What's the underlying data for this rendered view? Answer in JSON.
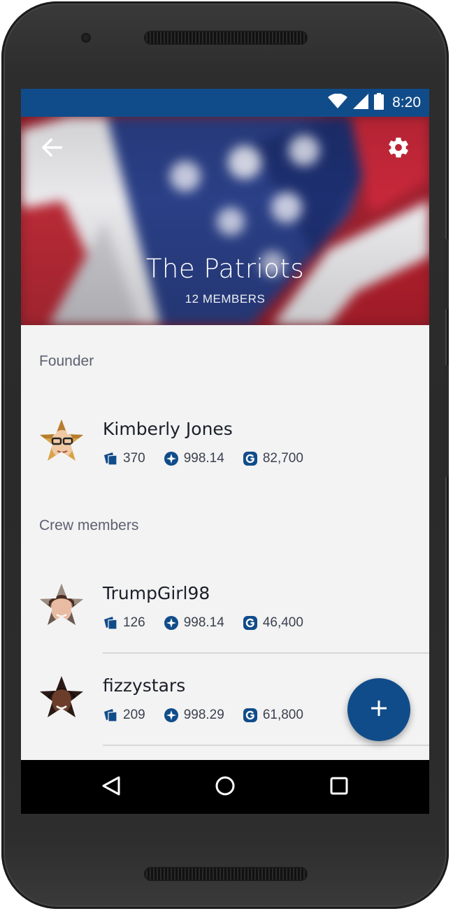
{
  "status_bar": {
    "time": "8:20"
  },
  "header": {
    "title": "The Patriots",
    "member_count": "12 MEMBERS"
  },
  "sections": {
    "founder": "Founder",
    "crew": "Crew members"
  },
  "founder": {
    "name": "Kimberly Jones",
    "cards": "370",
    "score": "998.14",
    "coins": "82,700"
  },
  "crew": [
    {
      "name": "TrumpGirl98",
      "cards": "126",
      "score": "998.14",
      "coins": "46,400"
    },
    {
      "name": "fizzystars",
      "cards": "209",
      "score": "998.29",
      "coins": "61,800"
    }
  ],
  "icons": {
    "back": "arrow-left-icon",
    "settings": "gear-icon",
    "cards": "cards-icon",
    "score": "star-badge-icon",
    "coins": "g-coin-icon",
    "fab": "plus-icon"
  },
  "colors": {
    "primary": "#114c8a",
    "background": "#f3f3f3",
    "text": "#1b1f2a",
    "label": "#5c6170"
  }
}
